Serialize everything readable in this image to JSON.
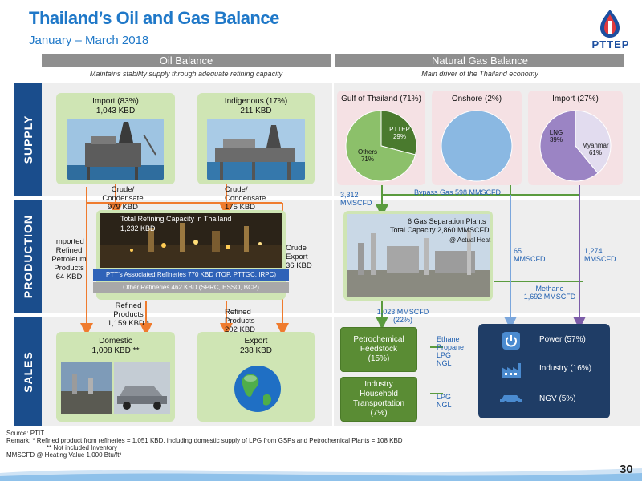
{
  "header": {
    "title": "Thailand’s Oil and Gas Balance",
    "subtitle": "January – March 2018",
    "logo_text": "PTTEP"
  },
  "sections": {
    "oil_title": "Oil Balance",
    "oil_sub": "Maintains stability supply through adequate refining capacity",
    "gas_title": "Natural Gas Balance",
    "gas_sub": "Main driver of the Thailand economy"
  },
  "rows": {
    "supply": "SUPPLY",
    "production": "PRODUCTION",
    "sales": "SALES"
  },
  "oil": {
    "import_title": "Import (83%)",
    "import_value": "1,043 KBD",
    "indigenous_title": "Indigenous (17%)",
    "indigenous_value": "211 KBD",
    "crude_left": "Crude/\nCondensate\n979 KBD",
    "crude_right": "Crude/\nCondensate\n175 KBD",
    "refining_title": "Total Refining Capacity in Thailand",
    "refining_value": "1,232 KBD",
    "ptt_refineries": "PTT’s Associated Refineries 770 KBD (TOP, PTTGC, IRPC)",
    "other_refineries": "Other Refineries 462 KBD (SPRC, ESSO, BCP)",
    "imported_refined": "Imported\nRefined\nPetroleum\nProducts\n64 KBD",
    "crude_export": "Crude\nExport\n36 KBD",
    "refined_products_left": "Refined\nProducts\n1,159 KBD *",
    "refined_products_right": "Refined\nProducts\n202 KBD",
    "domestic_title": "Domestic",
    "domestic_value": "1,008 KBD **",
    "export_title": "Export",
    "export_value": "238 KBD"
  },
  "gas": {
    "gulf_title": "Gulf of Thailand (71%)",
    "onshore_title": "Onshore (2%)",
    "import_title": "Import (27%)",
    "pie_gulf": [
      {
        "label": "PTTEP",
        "value": "29%"
      },
      {
        "label": "Others",
        "value": "71%"
      }
    ],
    "pie_import": [
      {
        "label": "LNG",
        "value": "39%"
      },
      {
        "label": "Myanmar",
        "value": "61%"
      }
    ],
    "left_flow": "3,312\nMMSCFD",
    "bypass": "Bypass Gas 598 MMSCFD",
    "plants_title": "6 Gas Separation Plants",
    "plants_capacity": "Total Capacity 2,860 MMSCFD",
    "plants_note": "@ Actual Heat",
    "flow_65": "65\nMMSCFD",
    "flow_1274": "1,274\nMMSCFD",
    "methane": "Methane\n1,692 MMSCFD",
    "flow_1023": "1,023 MMSCFD\n(22%)",
    "petrochem": "Petrochemical\nFeedstock\n(15%)",
    "petrochem_products": "Ethane\nPropane\nLPG\nNGL",
    "industry": "Industry\nHousehold\nTransportation\n(7%)",
    "industry_products": "LPG\nNGL",
    "power": "Power (57%)",
    "industry_sales": "Industry (16%)",
    "ngv": "NGV (5%)"
  },
  "footer": {
    "source": "Source: PTIT",
    "remark1": "Remark: * Refined product from refineries = 1,051 KBD, including domestic supply of LPG from GSPs and Petrochemical Plants = 108 KBD",
    "remark2": "** Not included Inventory",
    "remark3": "MMSCFD @ Heating Value 1,000 Btu/ft³",
    "page": "30"
  },
  "colors": {
    "title_blue": "#1f78c8",
    "side_navy": "#1a4d8c",
    "oil_arrow": "#ef7b2e",
    "gas_arrow": "#5a9b3e",
    "light_blue_arrow": "#7aa6dc",
    "purple_arrow": "#7b5ca8",
    "green_box": "#cfe5b4",
    "pink_box": "#f5e1e4"
  },
  "chart_data": [
    {
      "type": "pie",
      "title": "Gulf of Thailand (71%)",
      "categories": [
        "PTTEP",
        "Others"
      ],
      "values": [
        29,
        71
      ]
    },
    {
      "type": "pie",
      "title": "Onshore (2%)",
      "categories": [],
      "values": [
        100
      ]
    },
    {
      "type": "pie",
      "title": "Import (27%)",
      "categories": [
        "LNG",
        "Myanmar"
      ],
      "values": [
        39,
        61
      ]
    }
  ]
}
